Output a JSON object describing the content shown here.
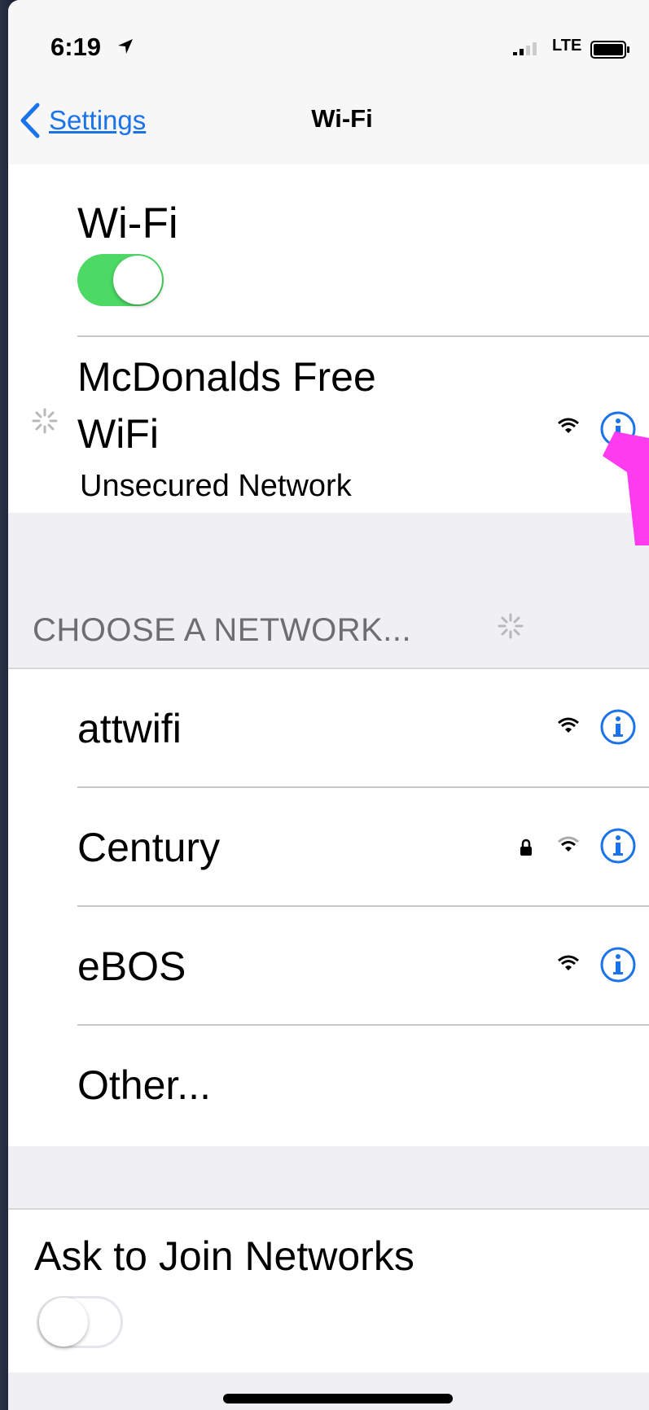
{
  "status_bar": {
    "time": "6:19",
    "network_type": "LTE"
  },
  "nav": {
    "back_label": "Settings",
    "title": "Wi-Fi"
  },
  "wifi": {
    "label": "Wi-Fi",
    "enabled": true,
    "current_network": {
      "name": "McDonalds Free WiFi",
      "subtitle": "Unsecured Network"
    }
  },
  "networks_section": {
    "header": "CHOOSE A NETWORK...",
    "items": [
      {
        "name": "attwifi",
        "locked": false
      },
      {
        "name": "Century",
        "locked": true
      },
      {
        "name": "eBOS",
        "locked": false
      },
      {
        "name": "Other...",
        "locked": false
      }
    ]
  },
  "ask_to_join": {
    "label": "Ask to Join Networks",
    "enabled": false
  },
  "colors": {
    "accent": "#1a73e8",
    "switch_on": "#4cd964",
    "annotation": "#ff3bf0"
  }
}
